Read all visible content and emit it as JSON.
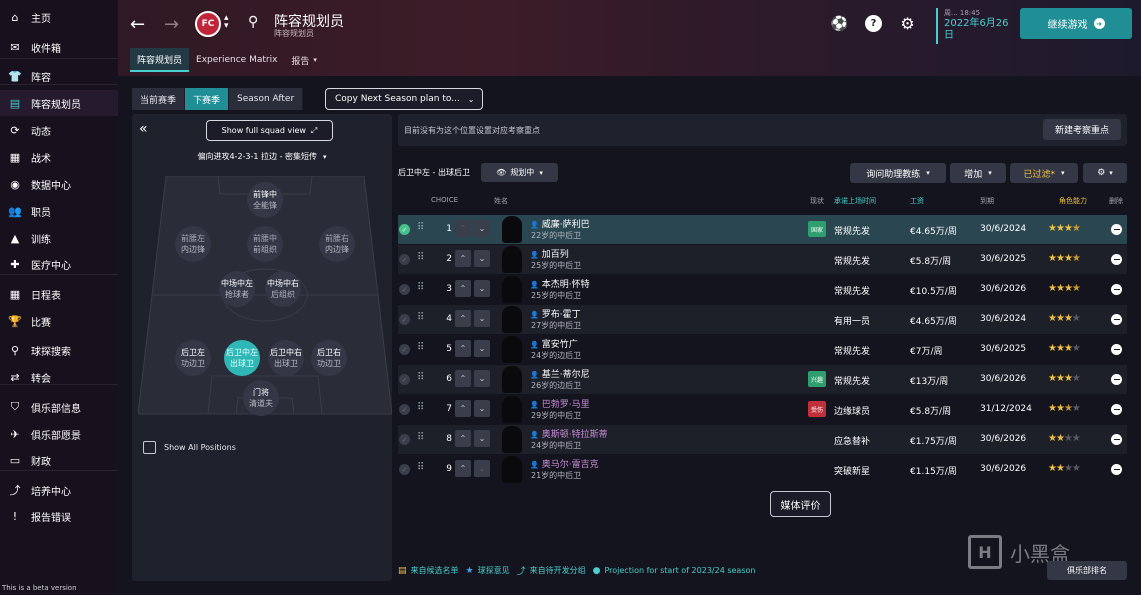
{
  "sidebar": {
    "items": [
      {
        "icon": "home-icon",
        "glyph": "⌂",
        "label": "主页"
      },
      {
        "icon": "inbox-icon",
        "glyph": "✉",
        "label": "收件箱"
      },
      {
        "icon": "shirt-icon",
        "glyph": "👕",
        "label": "阵容"
      },
      {
        "icon": "clipboard-icon",
        "glyph": "▤",
        "label": "阵容规划员"
      },
      {
        "icon": "dynamics-icon",
        "glyph": "⟳",
        "label": "动态"
      },
      {
        "icon": "tactics-icon",
        "glyph": "▦",
        "label": "战术"
      },
      {
        "icon": "data-hub-icon",
        "glyph": "◉",
        "label": "数据中心"
      },
      {
        "icon": "staff-icon",
        "glyph": "👥",
        "label": "职员"
      },
      {
        "icon": "training-icon",
        "glyph": "▲",
        "label": "训练"
      },
      {
        "icon": "medical-icon",
        "glyph": "✚",
        "label": "医疗中心"
      },
      {
        "icon": "calendar-icon",
        "glyph": "▦",
        "label": "日程表"
      },
      {
        "icon": "trophy-icon",
        "glyph": "🏆",
        "label": "比赛"
      },
      {
        "icon": "scouting-icon",
        "glyph": "⚲",
        "label": "球探搜索"
      },
      {
        "icon": "transfers-icon",
        "glyph": "⇄",
        "label": "转会"
      },
      {
        "icon": "club-info-icon",
        "glyph": "⛉",
        "label": "俱乐部信息"
      },
      {
        "icon": "club-vision-icon",
        "glyph": "✈",
        "label": "俱乐部愿景"
      },
      {
        "icon": "finances-icon",
        "glyph": "▭",
        "label": "财政"
      },
      {
        "icon": "development-icon",
        "glyph": "⤴",
        "label": "培养中心"
      },
      {
        "icon": "report-bug-icon",
        "glyph": "!",
        "label": "报告错误"
      }
    ],
    "beta_text": "This is a beta version"
  },
  "header": {
    "title": "阵容规划员",
    "subtitle": "阵容规划员",
    "club_badge_text": "FC",
    "tabs": [
      "阵容规划员",
      "Experience Matrix",
      "报告"
    ],
    "time": "周... 18:45",
    "date": "2022年6月26日",
    "continue_label": "继续游戏"
  },
  "controls": {
    "season_tabs": [
      "当前赛季",
      "下赛季",
      "Season After"
    ],
    "copy_plan_label": "Copy Next Season plan to...",
    "show_full_label": "Show full squad view",
    "formation": "偏向进攻4-2-3-1 拉边 - 密集短传",
    "show_all_positions": "Show All Positions"
  },
  "pitch_positions": [
    {
      "name": "前锋中",
      "role": "全能锋",
      "sel": false,
      "dim": false
    },
    {
      "name": "前腰左",
      "role": "内边锋",
      "sel": false,
      "dim": true
    },
    {
      "name": "前腰中",
      "role": "前组织",
      "sel": false,
      "dim": true
    },
    {
      "name": "前腰右",
      "role": "内边锋",
      "sel": false,
      "dim": true
    },
    {
      "name": "中场中左",
      "role": "抢球者",
      "sel": false,
      "dim": false
    },
    {
      "name": "中场中右",
      "role": "后组织",
      "sel": false,
      "dim": false
    },
    {
      "name": "后卫左",
      "role": "功边卫",
      "sel": false,
      "dim": false
    },
    {
      "name": "后卫中左",
      "role": "出球卫",
      "sel": true,
      "dim": false
    },
    {
      "name": "后卫中右",
      "role": "出球卫",
      "sel": false,
      "dim": false
    },
    {
      "name": "后卫右",
      "role": "功边卫",
      "sel": false,
      "dim": false
    },
    {
      "name": "门将",
      "role": "清道夫",
      "sel": false,
      "dim": false
    }
  ],
  "info": {
    "no_focus_text": "目前没有为这个位置设置对应考察重点",
    "new_focus_label": "新建考察重点"
  },
  "position_header": {
    "label": "后卫中左 - 出球后卫",
    "plan_status": "规划中",
    "ask_coach": "询问助理教练",
    "add": "增加",
    "filtered": "已过滤*"
  },
  "table": {
    "headers": [
      "CHOICE",
      "姓名",
      "现状",
      "承诺上场时间",
      "工资",
      "到期",
      "角色能力",
      "删除"
    ],
    "rows": [
      {
        "choice": "1",
        "name": "威廉·萨利巴",
        "desc": "22岁的中后卫",
        "purple": false,
        "status": "国家",
        "status_color": "#2e9e6e",
        "role": "常规先发",
        "wage": "€4.65万/周",
        "expires": "30/6/2024",
        "stars": 3.5
      },
      {
        "choice": "2",
        "name": "加百列",
        "desc": "25岁的中后卫",
        "purple": false,
        "status": "",
        "status_color": "",
        "role": "常规先发",
        "wage": "€5.8万/周",
        "expires": "30/6/2025",
        "stars": 3.5
      },
      {
        "choice": "3",
        "name": "本杰明·怀特",
        "desc": "25岁的中后卫",
        "purple": false,
        "status": "",
        "status_color": "",
        "role": "常规先发",
        "wage": "€10.5万/周",
        "expires": "30/6/2026",
        "stars": 3.5
      },
      {
        "choice": "4",
        "name": "罗布·霍丁",
        "desc": "27岁的中后卫",
        "purple": false,
        "status": "",
        "status_color": "",
        "role": "有用一员",
        "wage": "€4.65万/周",
        "expires": "30/6/2024",
        "stars": 3
      },
      {
        "choice": "5",
        "name": "富安竹广",
        "desc": "24岁的边后卫",
        "purple": false,
        "status": "",
        "status_color": "",
        "role": "常规先发",
        "wage": "€7万/周",
        "expires": "30/6/2025",
        "stars": 3
      },
      {
        "choice": "6",
        "name": "基兰·蒂尔尼",
        "desc": "26岁的边后卫",
        "purple": false,
        "status": "兴趣",
        "status_color": "#2e9e6e",
        "role": "常规先发",
        "wage": "€13万/周",
        "expires": "30/6/2026",
        "stars": 3
      },
      {
        "choice": "7",
        "name": "巴勃罗·马里",
        "desc": "29岁的中后卫",
        "purple": true,
        "status": "受伤",
        "status_color": "#c0303a",
        "role": "边缘球员",
        "wage": "€5.8万/周",
        "expires": "31/12/2024",
        "stars": 2.5
      },
      {
        "choice": "8",
        "name": "奥斯顿·特拉斯蒂",
        "desc": "24岁的中后卫",
        "purple": true,
        "status": "",
        "status_color": "",
        "role": "应急替补",
        "wage": "€1.75万/周",
        "expires": "30/6/2026",
        "stars": 2
      },
      {
        "choice": "9",
        "name": "奥马尔·雷吉克",
        "desc": "21岁的中后卫",
        "purple": true,
        "status": "",
        "status_color": "",
        "role": "突破新星",
        "wage": "€1.15万/周",
        "expires": "30/6/2026",
        "stars": 2
      }
    ]
  },
  "media_label": "媒体评价",
  "legend": [
    {
      "icon": "shortlist-icon",
      "glyph": "▤",
      "label": "来自候选名单",
      "color": "#f0c040"
    },
    {
      "icon": "scout-star-icon",
      "glyph": "★",
      "label": "球探意见",
      "color": "#4aa0f0"
    },
    {
      "icon": "development-icon",
      "glyph": "⤴",
      "label": "来自待开发分组",
      "color": "#48d0d0"
    },
    {
      "icon": "projection-dot-icon",
      "glyph": "●",
      "label": "Projection for start of 2023/24 season",
      "color": "#48d0d0"
    }
  ],
  "club_rank_label": "俱乐部排名",
  "watermark": "小黑盒",
  "colors": {
    "accent": "#48d0d0",
    "button": "#1f8e95",
    "star": "#f0c040"
  }
}
